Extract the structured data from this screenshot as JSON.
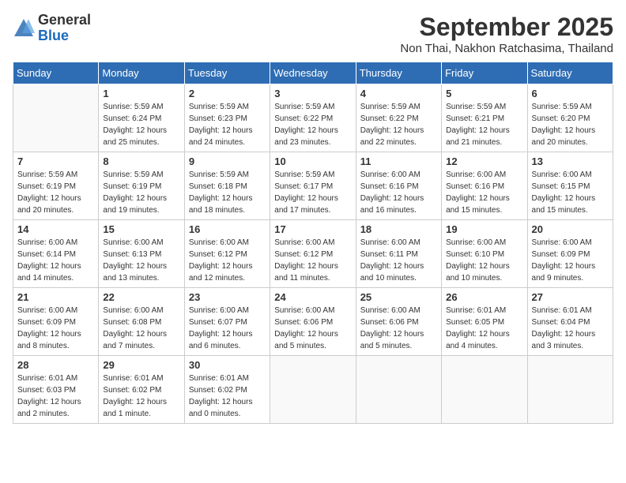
{
  "header": {
    "logo_general": "General",
    "logo_blue": "Blue",
    "month": "September 2025",
    "location": "Non Thai, Nakhon Ratchasima, Thailand"
  },
  "weekdays": [
    "Sunday",
    "Monday",
    "Tuesday",
    "Wednesday",
    "Thursday",
    "Friday",
    "Saturday"
  ],
  "weeks": [
    [
      {
        "day": "",
        "info": ""
      },
      {
        "day": "1",
        "info": "Sunrise: 5:59 AM\nSunset: 6:24 PM\nDaylight: 12 hours\nand 25 minutes."
      },
      {
        "day": "2",
        "info": "Sunrise: 5:59 AM\nSunset: 6:23 PM\nDaylight: 12 hours\nand 24 minutes."
      },
      {
        "day": "3",
        "info": "Sunrise: 5:59 AM\nSunset: 6:22 PM\nDaylight: 12 hours\nand 23 minutes."
      },
      {
        "day": "4",
        "info": "Sunrise: 5:59 AM\nSunset: 6:22 PM\nDaylight: 12 hours\nand 22 minutes."
      },
      {
        "day": "5",
        "info": "Sunrise: 5:59 AM\nSunset: 6:21 PM\nDaylight: 12 hours\nand 21 minutes."
      },
      {
        "day": "6",
        "info": "Sunrise: 5:59 AM\nSunset: 6:20 PM\nDaylight: 12 hours\nand 20 minutes."
      }
    ],
    [
      {
        "day": "7",
        "info": "Sunrise: 5:59 AM\nSunset: 6:19 PM\nDaylight: 12 hours\nand 20 minutes."
      },
      {
        "day": "8",
        "info": "Sunrise: 5:59 AM\nSunset: 6:19 PM\nDaylight: 12 hours\nand 19 minutes."
      },
      {
        "day": "9",
        "info": "Sunrise: 5:59 AM\nSunset: 6:18 PM\nDaylight: 12 hours\nand 18 minutes."
      },
      {
        "day": "10",
        "info": "Sunrise: 5:59 AM\nSunset: 6:17 PM\nDaylight: 12 hours\nand 17 minutes."
      },
      {
        "day": "11",
        "info": "Sunrise: 6:00 AM\nSunset: 6:16 PM\nDaylight: 12 hours\nand 16 minutes."
      },
      {
        "day": "12",
        "info": "Sunrise: 6:00 AM\nSunset: 6:16 PM\nDaylight: 12 hours\nand 15 minutes."
      },
      {
        "day": "13",
        "info": "Sunrise: 6:00 AM\nSunset: 6:15 PM\nDaylight: 12 hours\nand 15 minutes."
      }
    ],
    [
      {
        "day": "14",
        "info": "Sunrise: 6:00 AM\nSunset: 6:14 PM\nDaylight: 12 hours\nand 14 minutes."
      },
      {
        "day": "15",
        "info": "Sunrise: 6:00 AM\nSunset: 6:13 PM\nDaylight: 12 hours\nand 13 minutes."
      },
      {
        "day": "16",
        "info": "Sunrise: 6:00 AM\nSunset: 6:12 PM\nDaylight: 12 hours\nand 12 minutes."
      },
      {
        "day": "17",
        "info": "Sunrise: 6:00 AM\nSunset: 6:12 PM\nDaylight: 12 hours\nand 11 minutes."
      },
      {
        "day": "18",
        "info": "Sunrise: 6:00 AM\nSunset: 6:11 PM\nDaylight: 12 hours\nand 10 minutes."
      },
      {
        "day": "19",
        "info": "Sunrise: 6:00 AM\nSunset: 6:10 PM\nDaylight: 12 hours\nand 10 minutes."
      },
      {
        "day": "20",
        "info": "Sunrise: 6:00 AM\nSunset: 6:09 PM\nDaylight: 12 hours\nand 9 minutes."
      }
    ],
    [
      {
        "day": "21",
        "info": "Sunrise: 6:00 AM\nSunset: 6:09 PM\nDaylight: 12 hours\nand 8 minutes."
      },
      {
        "day": "22",
        "info": "Sunrise: 6:00 AM\nSunset: 6:08 PM\nDaylight: 12 hours\nand 7 minutes."
      },
      {
        "day": "23",
        "info": "Sunrise: 6:00 AM\nSunset: 6:07 PM\nDaylight: 12 hours\nand 6 minutes."
      },
      {
        "day": "24",
        "info": "Sunrise: 6:00 AM\nSunset: 6:06 PM\nDaylight: 12 hours\nand 5 minutes."
      },
      {
        "day": "25",
        "info": "Sunrise: 6:00 AM\nSunset: 6:06 PM\nDaylight: 12 hours\nand 5 minutes."
      },
      {
        "day": "26",
        "info": "Sunrise: 6:01 AM\nSunset: 6:05 PM\nDaylight: 12 hours\nand 4 minutes."
      },
      {
        "day": "27",
        "info": "Sunrise: 6:01 AM\nSunset: 6:04 PM\nDaylight: 12 hours\nand 3 minutes."
      }
    ],
    [
      {
        "day": "28",
        "info": "Sunrise: 6:01 AM\nSunset: 6:03 PM\nDaylight: 12 hours\nand 2 minutes."
      },
      {
        "day": "29",
        "info": "Sunrise: 6:01 AM\nSunset: 6:02 PM\nDaylight: 12 hours\nand 1 minute."
      },
      {
        "day": "30",
        "info": "Sunrise: 6:01 AM\nSunset: 6:02 PM\nDaylight: 12 hours\nand 0 minutes."
      },
      {
        "day": "",
        "info": ""
      },
      {
        "day": "",
        "info": ""
      },
      {
        "day": "",
        "info": ""
      },
      {
        "day": "",
        "info": ""
      }
    ]
  ]
}
